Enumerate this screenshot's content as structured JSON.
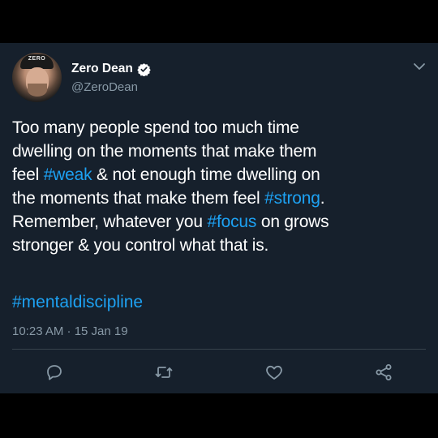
{
  "user": {
    "display_name": "Zero Dean",
    "handle": "@ZeroDean",
    "avatar_cap_text": "ZERO",
    "verified": true
  },
  "tweet": {
    "lines": [
      [
        {
          "t": "Too many people spend too much time"
        }
      ],
      [
        {
          "t": "dwelling on the moments that make them"
        }
      ],
      [
        {
          "t": "feel "
        },
        {
          "t": "#weak",
          "tag": true
        },
        {
          "t": " & not enough time dwelling on"
        }
      ],
      [
        {
          "t": "the moments that make them feel "
        },
        {
          "t": "#strong",
          "tag": true
        },
        {
          "t": "."
        }
      ],
      [
        {
          "t": "Remember, whatever you "
        },
        {
          "t": "#focus",
          "tag": true
        },
        {
          "t": " on grows"
        }
      ],
      [
        {
          "t": "stronger & you control what that is."
        }
      ]
    ],
    "hashtag_line": "#mentaldiscipline",
    "timestamp": "10:23 AM · 15 Jan 19"
  },
  "actions": [
    {
      "name": "reply-icon"
    },
    {
      "name": "retweet-icon"
    },
    {
      "name": "like-icon"
    },
    {
      "name": "share-icon"
    }
  ],
  "colors": {
    "background": "#16202c",
    "text": "#ffffff",
    "secondary_text": "#8899a6",
    "hashtag": "#1da1f2",
    "divider": "#38444d"
  }
}
